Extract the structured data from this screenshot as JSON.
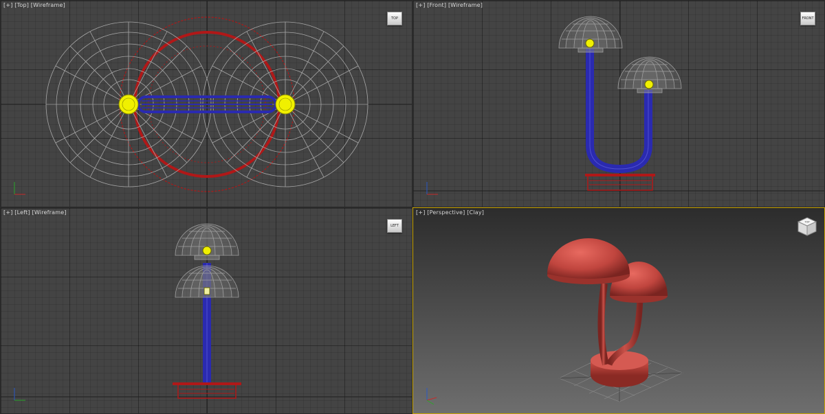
{
  "viewports": [
    {
      "id": "top",
      "labels": [
        "[+]",
        "[Top]",
        "[Wireframe]"
      ],
      "cube": "TOP"
    },
    {
      "id": "front",
      "labels": [
        "[+]",
        "[Front]",
        "[Wireframe]"
      ],
      "cube": "FRONT"
    },
    {
      "id": "left",
      "labels": [
        "[+]",
        "[Left]",
        "[Wireframe]"
      ],
      "cube": "LEFT"
    },
    {
      "id": "persp",
      "labels": [
        "[+]",
        "[Perspective]",
        "[Clay]"
      ],
      "cube": "TOP"
    }
  ],
  "colors": {
    "wire_gray": "#9a9a9a",
    "wire_red": "#b01818",
    "wire_blue": "#2a2ab0",
    "bulb": "#f0f000",
    "clay": "#c0453e"
  }
}
